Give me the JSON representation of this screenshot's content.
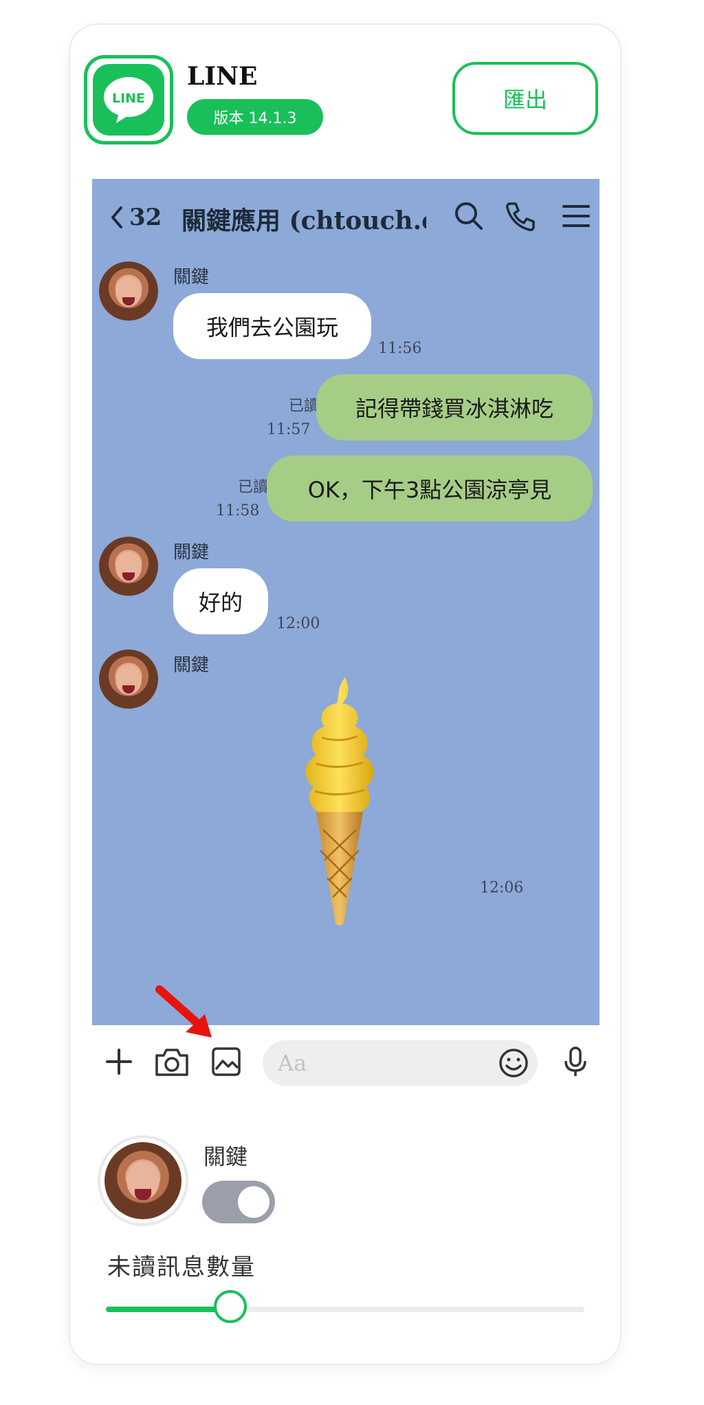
{
  "app": {
    "name": "LINE",
    "logo_text": "LINE",
    "version": "版本 14.1.3",
    "export_label": "匯出",
    "brand_color": "#19c059"
  },
  "chat": {
    "background": "#8da9d8",
    "unread_count": "32",
    "title": "關鍵應用 (chtouch.c",
    "header_icons": [
      "search-icon",
      "phone-icon",
      "menu-icon"
    ],
    "messages": [
      {
        "direction": "in",
        "sender": "關鍵",
        "text": "我們去公園玩",
        "time": "11:56"
      },
      {
        "direction": "out",
        "text": "記得帶錢買冰淇淋吃",
        "status": "已讀",
        "time": "11:57"
      },
      {
        "direction": "out",
        "text": "OK，下午3點公園涼亭見",
        "status": "已讀",
        "time": "11:58"
      },
      {
        "direction": "in",
        "sender": "關鍵",
        "text": "好的",
        "time": "12:00"
      },
      {
        "direction": "in",
        "sender": "關鍵",
        "sticker": "ice-cream-cone-sticker",
        "time": "12:06"
      }
    ]
  },
  "composer": {
    "icons": [
      "plus-icon",
      "camera-icon",
      "image-icon",
      "smiley-icon",
      "microphone-icon"
    ],
    "placeholder": "Aa",
    "highlighted_icon": "image-icon"
  },
  "settings": {
    "contact_name": "關鍵",
    "toggle_on": false,
    "unread_label": "未讀訊息數量",
    "unread_slider_fraction": 0.26
  }
}
